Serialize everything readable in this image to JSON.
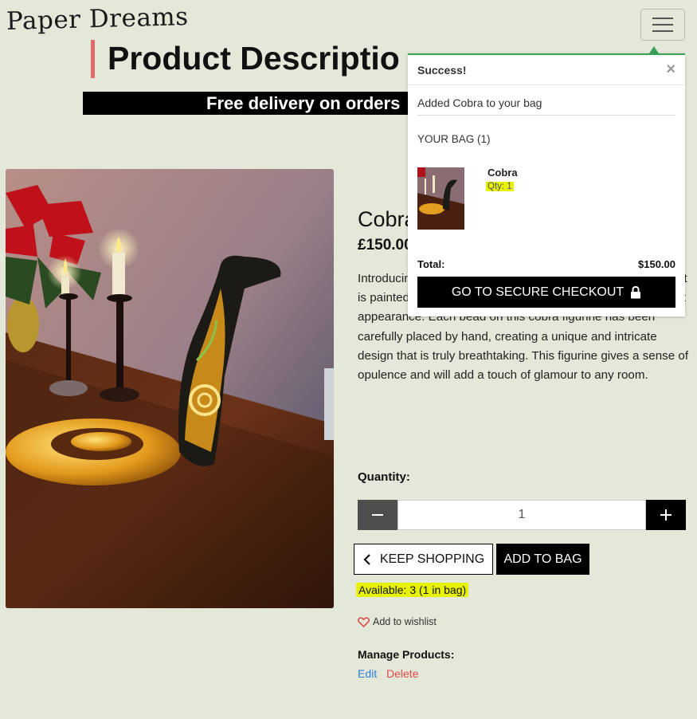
{
  "header": {
    "logo": "Paper Dreams"
  },
  "page": {
    "title": "Product Descriptio",
    "banner": "Free delivery on orders"
  },
  "product": {
    "name": "Cobra",
    "price": "£150.00",
    "description": "Introducing painstaki exquisite piece of art stands 46cm tall. It is painted in a beautiful gold hue, giving it a regal and elegant appearance. Each bead on this cobra figurine has been carefully placed by hand, creating a unique and intricate design that is truly breathtaking. This figurine gives a sense of opulence and will add a touch of glamour to any room.",
    "quantity_label": "Quantity:",
    "quantity_value": "1",
    "keep_shopping_label": "KEEP SHOPPING",
    "add_to_bag_label": "ADD TO BAG",
    "availability": "Available: 3 (1 in bag)",
    "wishlist_label": "Add to wishlist",
    "manage_label": "Manage Products:",
    "edit_label": "Edit",
    "delete_label": "Delete"
  },
  "toast": {
    "title": "Success!",
    "close_glyph": "×",
    "message": "Added Cobra to your bag",
    "bag_title": "YOUR BAG (1)",
    "item_name": "Cobra",
    "item_qty": "Qty: 1",
    "total_label": "Total:",
    "total_value": "$150.00",
    "checkout_label": "GO TO SECURE CHECKOUT",
    "accent_color": "#3aa05a"
  },
  "icons": {
    "menu": "hamburger-icon",
    "minus": "minus-icon",
    "plus": "plus-icon",
    "back": "chevron-left-icon",
    "wishlist": "heart-icon",
    "lock": "lock-icon",
    "close": "close-icon"
  }
}
